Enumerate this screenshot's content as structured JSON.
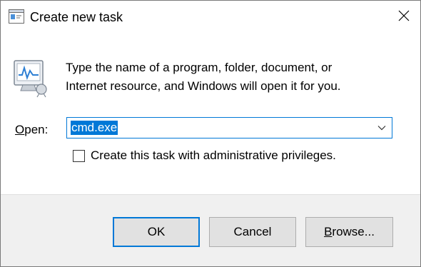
{
  "window": {
    "title": "Create new task",
    "title_icon": "run-dialog-icon",
    "close_icon": "close-icon"
  },
  "body": {
    "app_icon": "task-manager-icon",
    "description_line1": "Type the name of a program, folder, document, or",
    "description_line2": "Internet resource, and Windows will open it for you.",
    "open_label_accel": "O",
    "open_label_rest": "pen:",
    "open_value": "cmd.exe",
    "dropdown_icon": "chevron-down-icon",
    "admin_checkbox_label": "Create this task with administrative privileges.",
    "admin_checkbox_checked": false
  },
  "footer": {
    "ok_label": "OK",
    "cancel_label": "Cancel",
    "browse_accel": "B",
    "browse_rest": "rowse..."
  },
  "colors": {
    "accent": "#0078d7",
    "footer_bg": "#f0f0f0",
    "button_bg": "#e1e1e1"
  }
}
